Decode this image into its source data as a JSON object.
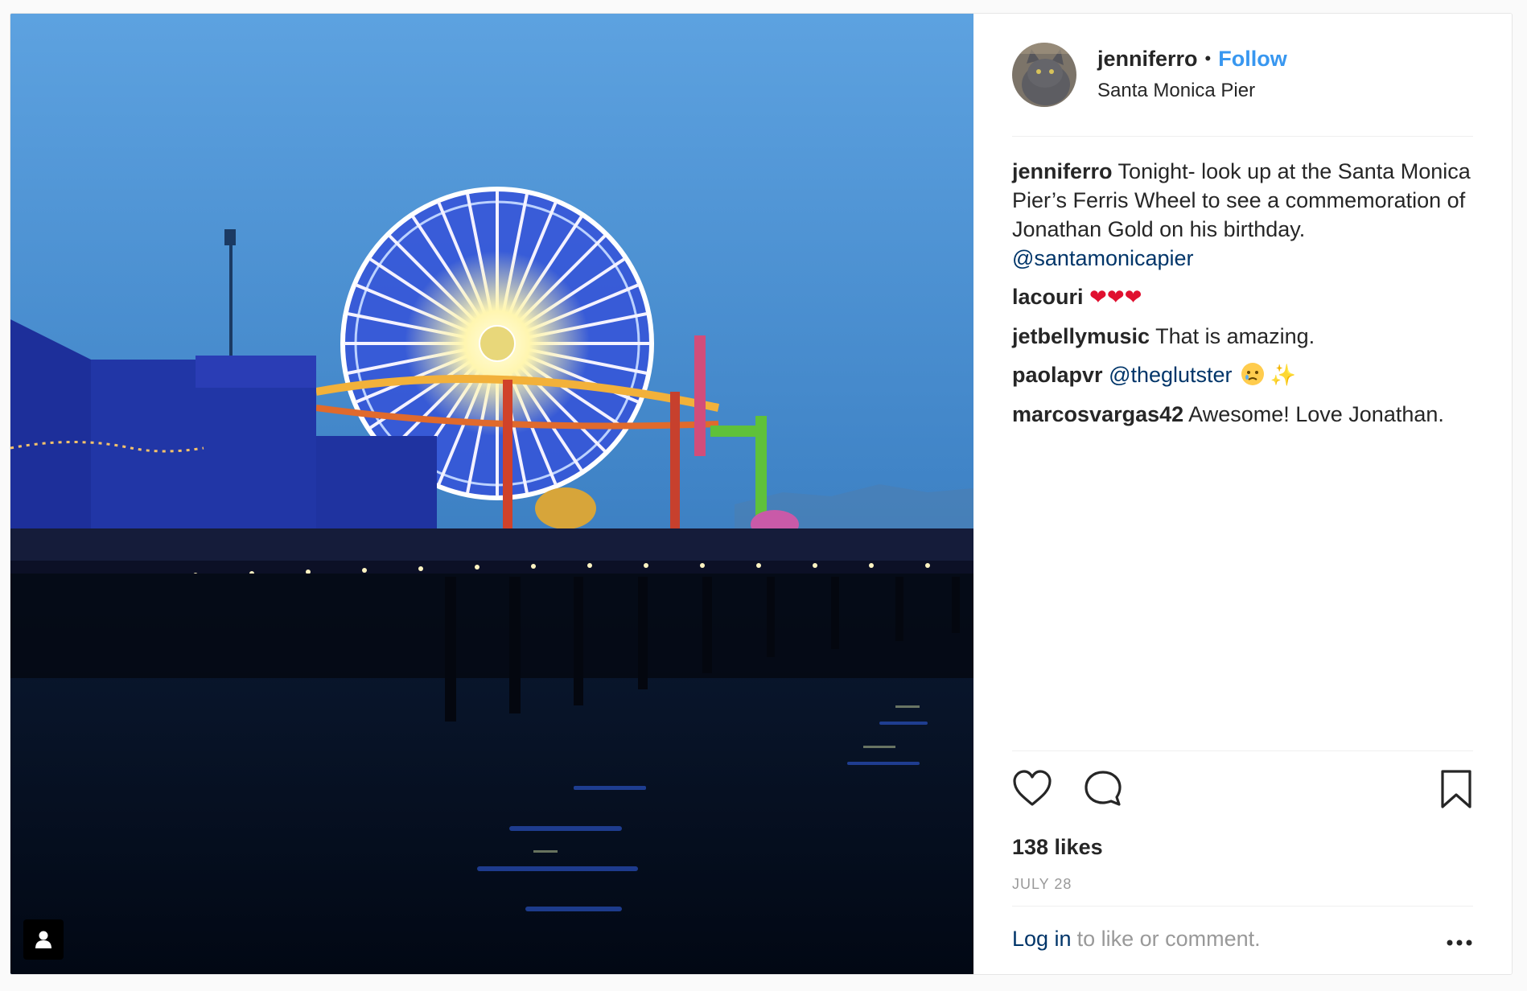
{
  "post": {
    "username": "jenniferro",
    "separator": "•",
    "follow_label": "Follow",
    "location": "Santa Monica Pier",
    "caption_user": "jenniferro",
    "caption_text": "Tonight- look up at the Santa Monica Pier’s Ferris Wheel to see a commemoration of Jonathan Gold on his birthday.",
    "caption_mention": "@santamonicapier",
    "likes": "138 likes",
    "date": "JULY 28"
  },
  "comments": [
    {
      "user": "lacouri",
      "text": "",
      "emoji": "❤❤❤"
    },
    {
      "user": "jetbellymusic",
      "text": "That is amazing."
    },
    {
      "user": "paolapvr",
      "mention": "@theglutster",
      "emoji_sparkle": "✨"
    },
    {
      "user": "marcosvargas42",
      "text": "Awesome! Love Jonathan."
    }
  ],
  "login": {
    "link": "Log in",
    "rest": "to like or comment."
  },
  "icons": {
    "like": "heart-icon",
    "comment": "comment-icon",
    "save": "bookmark-icon",
    "more": "more-options-icon",
    "tagged_user": "user-tag-icon"
  },
  "colors": {
    "follow": "#3897f0",
    "mention": "#003569",
    "muted": "#999999",
    "text": "#262626"
  }
}
